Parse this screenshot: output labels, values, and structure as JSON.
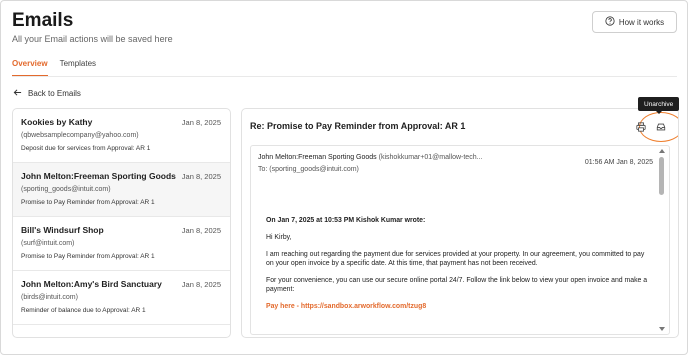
{
  "header": {
    "title": "Emails",
    "subtitle": "All your Email actions will be saved here",
    "how_it_works": "How it works"
  },
  "tabs": [
    {
      "label": "Overview",
      "active": true
    },
    {
      "label": "Templates",
      "active": false
    }
  ],
  "back_label": "Back to Emails",
  "emails": [
    {
      "name": "Kookies by Kathy",
      "date": "Jan 8, 2025",
      "email": "(qbwebsamplecompany@yahoo.com)",
      "subject": "Deposit due for services from Approval: AR 1"
    },
    {
      "name": "John Melton:Freeman Sporting Goods",
      "date": "Jan 8, 2025",
      "email": "(sporting_goods@intuit.com)",
      "subject": "Promise to Pay Reminder from Approval: AR 1"
    },
    {
      "name": "Bill's Windsurf Shop",
      "date": "Jan 8, 2025",
      "email": "(surf@intuit.com)",
      "subject": "Promise to Pay Reminder from Approval: AR 1"
    },
    {
      "name": "John Melton:Amy's Bird Sanctuary",
      "date": "Jan 8, 2025",
      "email": "(birds@intuit.com)",
      "subject": "Reminder of balance due to Approval: AR 1"
    }
  ],
  "detail": {
    "subject": "Re: Promise to Pay Reminder from Approval: AR 1",
    "from_name": "John Melton:Freeman Sporting Goods",
    "from_addr": "(kishokkumar+01@mallow-tech...",
    "to": "To: (sporting_goods@intuit.com)",
    "time": "01:56 AM Jan 8, 2025",
    "body": {
      "quote_header": "On Jan 7, 2025 at 10:53 PM Kishok Kumar wrote:",
      "greeting": "Hi Kirby,",
      "para1": "I am reaching out regarding the payment due for services provided at your property. In our agreement, you committed to pay on your open invoice by a specific date. At this time, that payment has not been received.",
      "para2": "For your convenience, you can use our secure online portal 24/7. Follow the link below to view your open invoice and make a payment:",
      "pay_link": "Pay here - https://sandbox.arworkflow.com/tzug8"
    }
  },
  "tooltip": "Unarchive",
  "icons": {
    "help": "help-circle-icon",
    "back": "arrow-left-icon",
    "print": "print-icon",
    "archive": "archive-box-icon"
  },
  "colors": {
    "accent": "#e36a2d",
    "highlight_oval": "#ef7f2e"
  }
}
